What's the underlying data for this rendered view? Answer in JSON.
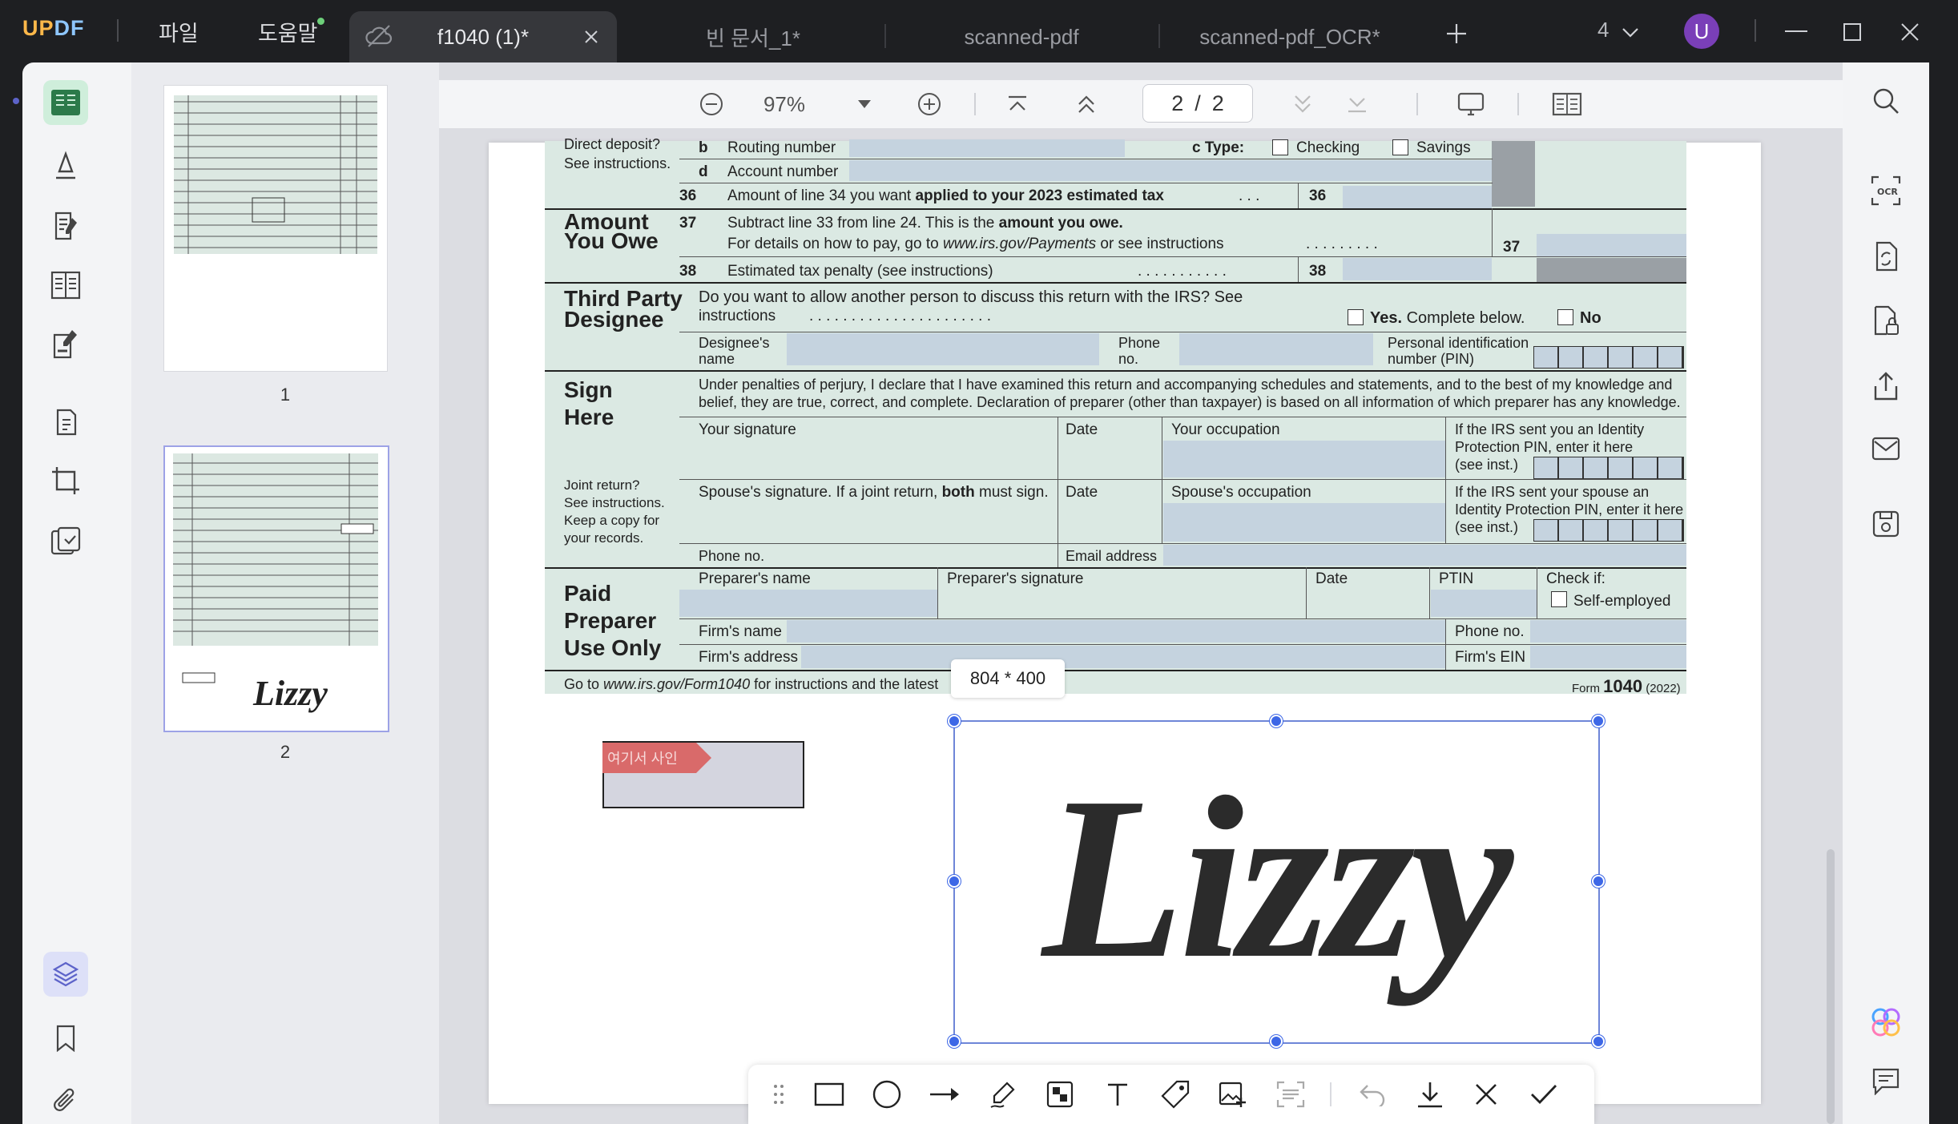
{
  "app": {
    "logo_u": "UP",
    "logo_r": "DF"
  },
  "menu": {
    "file": "파일",
    "help": "도움말"
  },
  "tabs": [
    {
      "label": "f1040 (1)*"
    },
    {
      "label": "빈 문서_1*"
    },
    {
      "label": "scanned-pdf"
    },
    {
      "label": "scanned-pdf_OCR*"
    }
  ],
  "window": {
    "tab_count": "4",
    "avatar_letter": "U"
  },
  "thumbnails": [
    {
      "num": "1"
    },
    {
      "num": "2"
    }
  ],
  "toolbar": {
    "zoom": "97%",
    "page_current": "2",
    "page_sep": "/",
    "page_total": "2"
  },
  "form": {
    "direct_deposit": "Direct deposit?",
    "see_instructions": "See instructions.",
    "b": "b",
    "routing_number": "Routing number",
    "c_type": "c Type:",
    "checking": "Checking",
    "savings": "Savings",
    "d": "d",
    "account_number": "Account number",
    "l36_num": "36",
    "l36_text_a": "Amount of line 34 you want ",
    "l36_text_b": "applied to your 2023 estimated tax",
    "l36_dots": ". . .",
    "l36_box": "36",
    "amount_you_owe_1": "Amount",
    "amount_you_owe_2": "You Owe",
    "l37_num": "37",
    "l37_text_a": "Subtract line 33 from line 24. This is the ",
    "l37_text_b": "amount you owe.",
    "l37_text_c": "For details on how to pay, go to ",
    "l37_url": "www.irs.gov/Payments",
    "l37_text_d": " or see instructions",
    "l37_dots": ". . . . . . . . .",
    "l37_box": "37",
    "l38_num": "38",
    "l38_text": "Estimated tax penalty (see instructions)",
    "l38_dots": ". . . . . . . . . . .",
    "l38_box": "38",
    "third_party_1": "Third Party",
    "third_party_2": "Designee",
    "tp_question": "Do you want to allow another person to discuss this return with the IRS? See",
    "tp_question2": "instructions",
    "tp_dots": ". . . . . . . . . . . . . . . . . . . . . .",
    "yes": "Yes.",
    "yes_rest": " Complete below.",
    "no": "No",
    "designee_name_1": "Designee's",
    "designee_name_2": "name",
    "phone_1": "Phone",
    "phone_2": "no.",
    "pin_1": "Personal identification",
    "pin_2": "number (PIN)",
    "sign_here_1": "Sign",
    "sign_here_2": "Here",
    "perjury_1": "Under penalties of perjury, I declare that I have examined this return and accompanying schedules and statements, and to the best of my knowledge and",
    "perjury_2": "belief, they are true, correct, and complete. Declaration of preparer (other than taxpayer) is based on all information of which preparer has any knowledge.",
    "your_signature": "Your signature",
    "date": "Date",
    "your_occupation": "Your occupation",
    "ip_pin_1": "If the IRS sent you an Identity",
    "ip_pin_2": "Protection PIN, enter it here",
    "ip_pin_3": "(see inst.)",
    "joint_1": "Joint return?",
    "joint_2": "See instructions.",
    "joint_3": "Keep a copy for",
    "joint_4": "your records.",
    "spouse_sig_a": "Spouse's signature. If a joint return, ",
    "spouse_sig_b": "both",
    "spouse_sig_c": " must sign.",
    "spouse_occupation": "Spouse's occupation",
    "sp_pin_1": "If the IRS sent your spouse an",
    "sp_pin_2": "Identity Protection PIN, enter it here",
    "sp_pin_3": "(see inst.)",
    "phone_no": "Phone no.",
    "email": "Email address",
    "paid_1": "Paid",
    "paid_2": "Preparer",
    "paid_3": "Use Only",
    "preparer_name": "Preparer's name",
    "preparer_sig": "Preparer's signature",
    "ptin": "PTIN",
    "check_if": "Check if:",
    "self_employed": "Self-employed",
    "firm_name": "Firm's name",
    "firm_phone": "Phone no.",
    "firm_address": "Firm's address",
    "firm_ein": "Firm's EIN",
    "footer_a": "Go to ",
    "footer_url": "www.irs.gov/Form1040",
    "footer_b": " for instructions and the latest",
    "form_word": "Form",
    "form_num": "1040",
    "form_year": "(2022)"
  },
  "stamp": {
    "label": "여기서 사인"
  },
  "selection": {
    "size": "804 * 400",
    "signature_text": "Lizzy"
  }
}
